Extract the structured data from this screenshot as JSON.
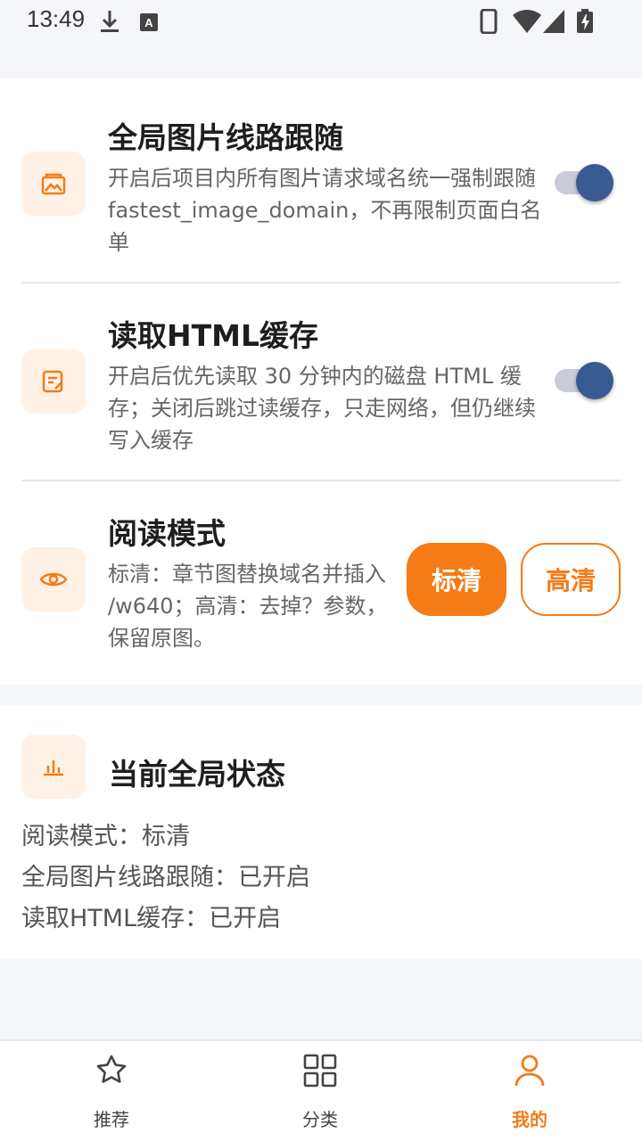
{
  "status_bar": {
    "time": "13:49",
    "icons": [
      "download-icon",
      "keyboard-a-icon",
      "phone-icon",
      "wifi-icon",
      "signal-icon",
      "battery-charging-icon"
    ]
  },
  "settings": {
    "image_domain": {
      "title": "全局图片线路跟随",
      "description": "开启后项目内所有图片请求域名统一强制跟随 fastest_image_domain，不再限制页面白名单",
      "enabled": true,
      "icon": "image-icon"
    },
    "html_cache": {
      "title": "读取HTML缓存",
      "description": "开启后优先读取 30 分钟内的磁盘 HTML 缓存；关闭后跳过读缓存，只走网络，但仍继续写入缓存",
      "enabled": true,
      "icon": "edit-document-icon"
    },
    "reading_mode": {
      "title": "阅读模式",
      "description": "标清：章节图替换域名并插入 /w640；高清：去掉？参数，保留原图。",
      "icon": "eye-icon",
      "options": [
        "标清",
        "高清"
      ],
      "selected": "标清"
    }
  },
  "global_status": {
    "title": "当前全局状态",
    "icon": "bar-chart-icon",
    "lines": [
      "阅读模式：标清",
      "全局图片线路跟随：已开启",
      "读取HTML缓存：已开启"
    ]
  },
  "bottom_nav": {
    "items": [
      {
        "label": "推荐",
        "icon": "star-icon",
        "active": false
      },
      {
        "label": "分类",
        "icon": "grid-icon",
        "active": false
      },
      {
        "label": "我的",
        "icon": "user-icon",
        "active": true
      }
    ]
  },
  "colors": {
    "accent": "#f47b16",
    "toggle_on": "#3a5a93",
    "icon_tile_bg": "#fff1e6"
  }
}
